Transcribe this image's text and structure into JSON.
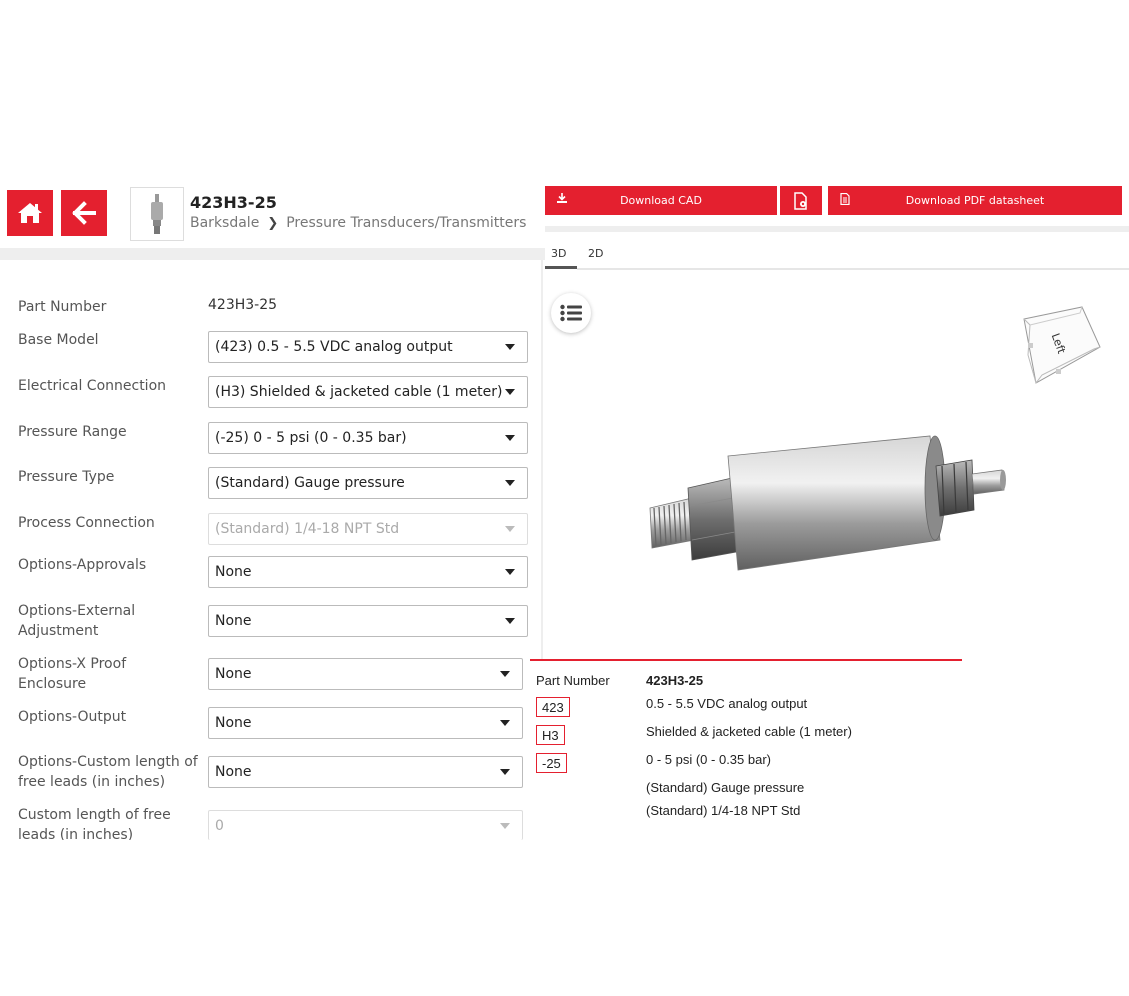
{
  "header": {
    "part_title": "423H3-25",
    "breadcrumb": [
      "Barksdale",
      "Pressure Transducers/Transmitters"
    ]
  },
  "toolbar": {
    "download_cad": "Download CAD",
    "download_pdf": "Download PDF datasheet"
  },
  "viewer": {
    "tabs": [
      "3D",
      "2D"
    ],
    "active_tab": "3D",
    "viewcube_face": "Left"
  },
  "form": {
    "part_number_label": "Part Number",
    "part_number_value": "423H3-25",
    "fields": [
      {
        "label": "Base Model",
        "value": "(423) 0.5 - 5.5 VDC analog output",
        "disabled": false
      },
      {
        "label": "Electrical Connection",
        "value": "(H3) Shielded & jacketed cable (1 meter)",
        "disabled": false
      },
      {
        "label": "Pressure Range",
        "value": "(-25) 0 - 5 psi (0 - 0.35 bar)",
        "disabled": false
      },
      {
        "label": "Pressure Type",
        "value": "(Standard) Gauge pressure",
        "disabled": false
      },
      {
        "label": "Process Connection",
        "value": "(Standard) 1/4-18 NPT Std",
        "disabled": true
      },
      {
        "label": "Options-Approvals",
        "value": "None",
        "disabled": false
      },
      {
        "label": "Options-External Adjustment",
        "value": "None",
        "disabled": false
      },
      {
        "label": "Options-X Proof Enclosure",
        "value": "None",
        "disabled": false
      },
      {
        "label": "Options-Output",
        "value": "None",
        "disabled": false
      },
      {
        "label": "Options-Custom length of free leads (in inches)",
        "value": "None",
        "disabled": false
      },
      {
        "label": "Custom length of free leads (in inches)",
        "value": "0",
        "disabled": true
      }
    ]
  },
  "summary": {
    "part_number_label": "Part Number",
    "part_number_value": "423H3-25",
    "codes": [
      {
        "code": "423",
        "text": "0.5 - 5.5 VDC analog output"
      },
      {
        "code": "H3",
        "text": "Shielded & jacketed cable (1 meter)"
      },
      {
        "code": "-25",
        "text": "0 - 5 psi (0 - 0.35 bar)"
      }
    ],
    "extra_lines": [
      "(Standard) Gauge pressure",
      "(Standard) 1/4-18 NPT Std"
    ]
  },
  "colors": {
    "accent": "#e4202f"
  }
}
